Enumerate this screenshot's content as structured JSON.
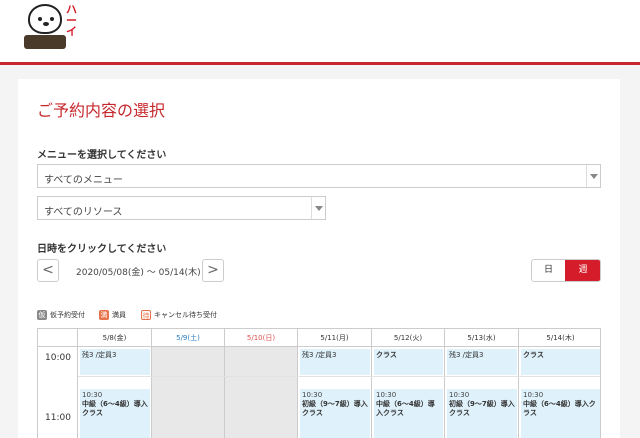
{
  "header": {
    "logo_alt": "logo",
    "logo_text": "ハーイ"
  },
  "page": {
    "title": "ご予約内容の選択"
  },
  "menu_section": {
    "label": "メニューを選択してください",
    "menu_select_value": "すべてのメニュー",
    "resource_select_value": "すべてのリソース"
  },
  "date_section": {
    "label": "日時をクリックしてください",
    "prev_label": "<",
    "next_label": ">",
    "range": "2020/05/08(金) ～ 05/14(木)",
    "view_day": "日",
    "view_week": "週"
  },
  "legend": [
    {
      "icon": "仮",
      "label": "仮予約受付",
      "color": "#888888"
    },
    {
      "icon": "満",
      "label": "満員",
      "color": "#e8734a"
    },
    {
      "icon": "待",
      "label": "キャンセル待ち受付",
      "color": "#ffffff"
    }
  ],
  "calendar": {
    "days": [
      {
        "label": "5/8(金)",
        "color": "#333333"
      },
      {
        "label": "5/9(土)",
        "color": "#2a7bbf"
      },
      {
        "label": "5/10(日)",
        "color": "#d9534f"
      },
      {
        "label": "5/11(月)",
        "color": "#333333"
      },
      {
        "label": "5/12(火)",
        "color": "#333333"
      },
      {
        "label": "5/13(水)",
        "color": "#333333"
      },
      {
        "label": "5/14(木)",
        "color": "#333333"
      }
    ],
    "times": [
      "10:00",
      "11:00"
    ],
    "row1": [
      {
        "text": "残3 /定員3"
      },
      {
        "text": ""
      },
      {
        "text": ""
      },
      {
        "text": "残3 /定員3"
      },
      {
        "text": "クラス"
      },
      {
        "text": "残3 /定員3"
      },
      {
        "text": "クラス"
      }
    ],
    "row2": [
      {
        "time": "10:30",
        "cls": "中級（6〜4級）導入クラス"
      },
      {
        "time": "",
        "cls": ""
      },
      {
        "time": "",
        "cls": ""
      },
      {
        "time": "10:30",
        "cls": "初級（9〜7級）導入クラス"
      },
      {
        "time": "10:30",
        "cls": "中級（6〜4級）導入クラス"
      },
      {
        "time": "10:30",
        "cls": "初級（9〜7級）導入クラス"
      },
      {
        "time": "10:30",
        "cls": "中級（6〜4級）導入クラス"
      }
    ]
  },
  "colors": {
    "accent": "#c7282d",
    "slot_bg": "#dff1fb"
  }
}
